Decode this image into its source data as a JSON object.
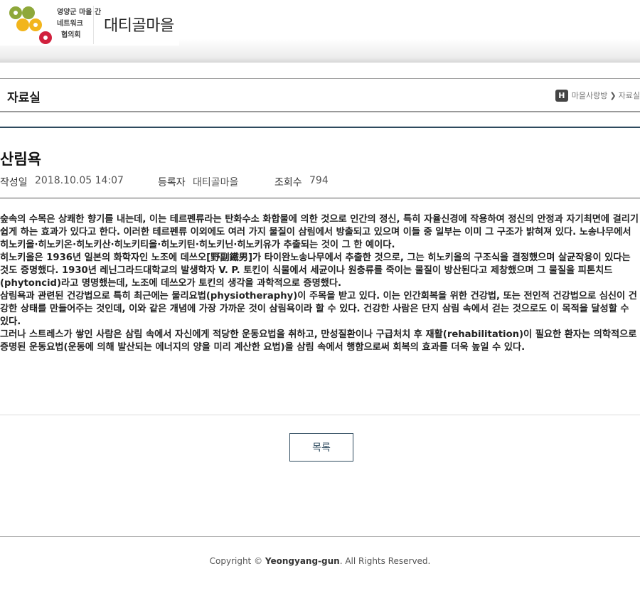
{
  "header": {
    "logo_line1": "영양군 마을 간",
    "logo_line2": "네트워크",
    "logo_line3": "협의회",
    "site_name": "대티골마을",
    "logo_colors": [
      "#8ea83a",
      "#f2b51c",
      "#d1203d"
    ]
  },
  "section": {
    "title": "자료실",
    "home_icon_label": "H",
    "breadcrumb": [
      "마을사랑방",
      "자료실"
    ]
  },
  "post": {
    "title": "산림욕",
    "meta": {
      "date_label": "작성일",
      "date_value": "2018.10.05 14:07",
      "author_label": "등록자",
      "author_value": "대티골마을",
      "views_label": "조회수",
      "views_value": "794"
    },
    "paragraphs": [
      "숲속의 수목은 상쾌한 향기를 내는데, 이는 테르펜류라는 탄화수소 화합물에 의한 것으로 인간의 정신, 특히 자율신경에 작용하여 정신의 안정과 자기최면에 걸리기 쉽게 하는 효과가 있다고 한다. 이러한 테르펜류 이외에도 여러 가지 물질이 삼림에서 방출되고 있으며 이들 중 일부는 이미 그 구조가 밝혀져 있다. 노송나무에서 히노키올·히노키온·히노키산·히노키티올·히노키틴·히노키닌·히노키유가 추출되는 것이 그 한 예이다.",
      "히노키올은 1936년 일본의 화학자인 노조에 데쓰오[野副鐵男]가 타이완노송나무에서 추출한 것으로, 그는 히노키올의 구조식을 결정했으며 살균작용이 있다는 것도 증명했다. 1930년 레닌그라드대학교의 발생학자 V. P. 토킨이 식물에서 세균이나 원충류를 죽이는 물질이 방산된다고 제창했으며 그 물질을 피톤치드(phytoncid)라고 명명했는데, 노조에 데쓰오가 토킨의 생각을 과학적으로 증명했다.",
      "삼림욕과 관련된 건강법으로 특히 최근에는 물리요법(physiotheraphy)이 주목을 받고 있다. 이는 인간회복을 위한 건강법, 또는 전인적 건강법으로 심신이 건강한 상태를 만들어주는 것인데, 이와 같은 개념에 가장 가까운 것이 삼림욕이라 할 수 있다. 건강한 사람은 단지 삼림 속에서 걷는 것으로도 이 목적을 달성할 수 있다.",
      "그러나 스트레스가 쌓인 사람은 삼림 속에서 자신에게 적당한 운동요법을 취하고, 만성질환이나 구급처치 후 재활(rehabilitation)이 필요한 환자는 의학적으로 증명된 운동요법(운동에 의해 발산되는 에너지의 양을 미리 계산한 요법)을 삼림 속에서 행함으로써 회복의 효과를 더욱 높일 수 있다."
    ]
  },
  "actions": {
    "list_button": "목록"
  },
  "footer": {
    "prefix": "Copyright © ",
    "brand": "Yeongyang-gun",
    "suffix": ". All Rights Reserved."
  }
}
